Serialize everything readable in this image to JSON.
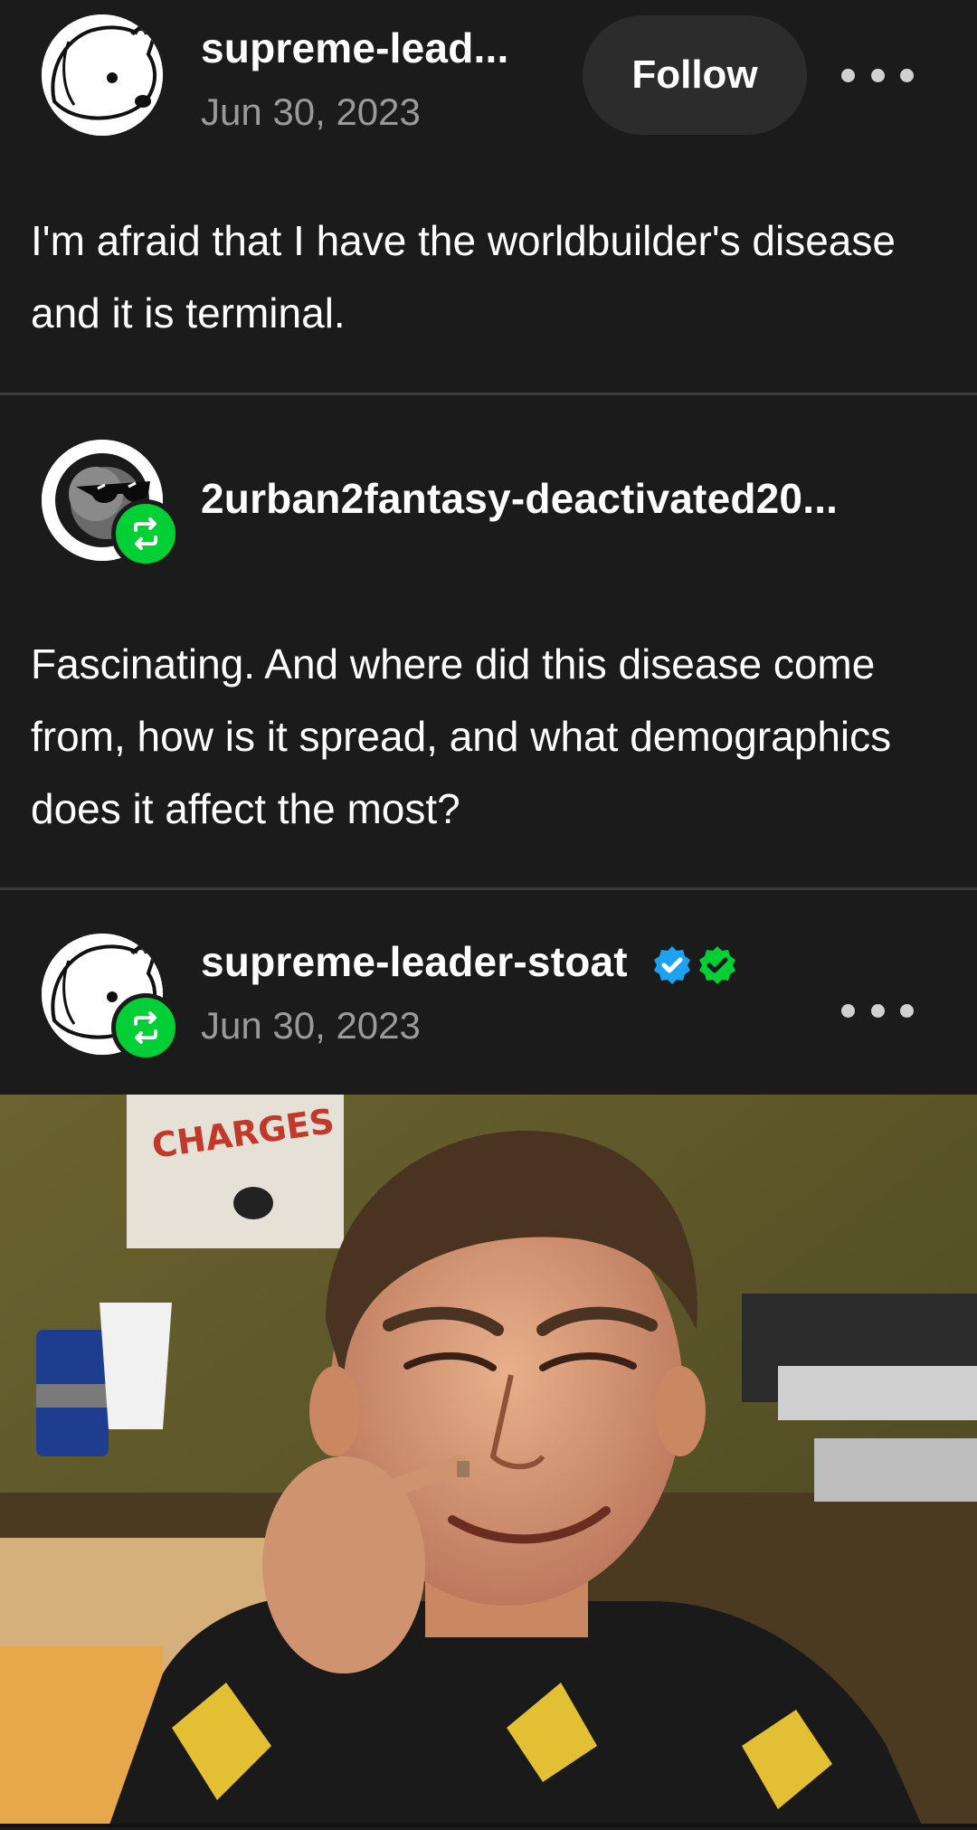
{
  "post1": {
    "username": "supreme-lead...",
    "date": "Jun 30, 2023",
    "follow_label": "Follow",
    "text": "I'm afraid that I have the worldbuilder's disease and it is terminal.",
    "avatar_icon": "stoat-avatar-icon",
    "more_icon": "more-options-icon"
  },
  "post2": {
    "username": "2urban2fantasy-deactivated20...",
    "text": "Fascinating. And where did this disease come from, how is it spread, and what demographics does it affect the most?",
    "avatar_icon": "sunglasses-avatar-icon",
    "badge_icon": "reblog-icon"
  },
  "post3": {
    "username": "supreme-leader-stoat",
    "date": "Jun 30, 2023",
    "avatar_icon": "stoat-avatar-icon",
    "badge_icon": "reblog-icon",
    "verified_icons": [
      "blue-check-badge-icon",
      "green-check-badge-icon"
    ],
    "more_icon": "more-options-icon",
    "image": {
      "sign_text": "CHARGES"
    }
  },
  "colors": {
    "background": "#1b1b1b",
    "reblog_green": "#00cf35",
    "verified_blue": "#1da1f2",
    "verified_green": "#00cf35",
    "date_gray": "#9a9a9a",
    "follow_button_bg": "#2c2c2c"
  }
}
